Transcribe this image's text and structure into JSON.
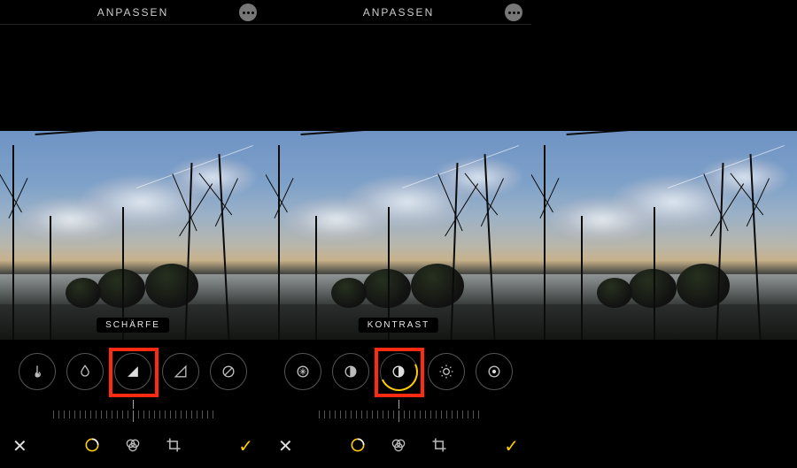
{
  "screens": [
    {
      "header": {
        "title": "ANPASSEN"
      },
      "adjust_label": "SCHÄRFE",
      "tools": [
        {
          "name": "warmth-icon"
        },
        {
          "name": "tint-icon"
        },
        {
          "name": "sharpness-icon",
          "selected": true
        },
        {
          "name": "definition-icon"
        },
        {
          "name": "noise-reduction-icon"
        }
      ]
    },
    {
      "header": {
        "title": "ANPASSEN"
      },
      "adjust_label": "KONTRAST",
      "tools": [
        {
          "name": "exposure-icon"
        },
        {
          "name": "brilliance-icon"
        },
        {
          "name": "contrast-icon",
          "selected": true
        },
        {
          "name": "brightness-icon"
        },
        {
          "name": "black-point-icon"
        }
      ]
    }
  ],
  "colors": {
    "accent": "#ffcc00",
    "highlight": "#ff2a12"
  }
}
